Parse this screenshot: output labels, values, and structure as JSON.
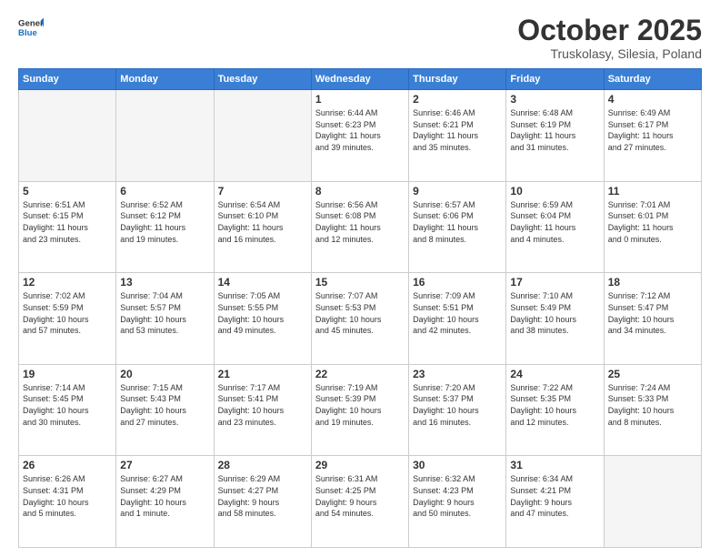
{
  "header": {
    "logo_line1": "General",
    "logo_line2": "Blue",
    "month": "October 2025",
    "location": "Truskolasy, Silesia, Poland"
  },
  "weekdays": [
    "Sunday",
    "Monday",
    "Tuesday",
    "Wednesday",
    "Thursday",
    "Friday",
    "Saturday"
  ],
  "weeks": [
    [
      {
        "day": "",
        "info": ""
      },
      {
        "day": "",
        "info": ""
      },
      {
        "day": "",
        "info": ""
      },
      {
        "day": "1",
        "info": "Sunrise: 6:44 AM\nSunset: 6:23 PM\nDaylight: 11 hours\nand 39 minutes."
      },
      {
        "day": "2",
        "info": "Sunrise: 6:46 AM\nSunset: 6:21 PM\nDaylight: 11 hours\nand 35 minutes."
      },
      {
        "day": "3",
        "info": "Sunrise: 6:48 AM\nSunset: 6:19 PM\nDaylight: 11 hours\nand 31 minutes."
      },
      {
        "day": "4",
        "info": "Sunrise: 6:49 AM\nSunset: 6:17 PM\nDaylight: 11 hours\nand 27 minutes."
      }
    ],
    [
      {
        "day": "5",
        "info": "Sunrise: 6:51 AM\nSunset: 6:15 PM\nDaylight: 11 hours\nand 23 minutes."
      },
      {
        "day": "6",
        "info": "Sunrise: 6:52 AM\nSunset: 6:12 PM\nDaylight: 11 hours\nand 19 minutes."
      },
      {
        "day": "7",
        "info": "Sunrise: 6:54 AM\nSunset: 6:10 PM\nDaylight: 11 hours\nand 16 minutes."
      },
      {
        "day": "8",
        "info": "Sunrise: 6:56 AM\nSunset: 6:08 PM\nDaylight: 11 hours\nand 12 minutes."
      },
      {
        "day": "9",
        "info": "Sunrise: 6:57 AM\nSunset: 6:06 PM\nDaylight: 11 hours\nand 8 minutes."
      },
      {
        "day": "10",
        "info": "Sunrise: 6:59 AM\nSunset: 6:04 PM\nDaylight: 11 hours\nand 4 minutes."
      },
      {
        "day": "11",
        "info": "Sunrise: 7:01 AM\nSunset: 6:01 PM\nDaylight: 11 hours\nand 0 minutes."
      }
    ],
    [
      {
        "day": "12",
        "info": "Sunrise: 7:02 AM\nSunset: 5:59 PM\nDaylight: 10 hours\nand 57 minutes."
      },
      {
        "day": "13",
        "info": "Sunrise: 7:04 AM\nSunset: 5:57 PM\nDaylight: 10 hours\nand 53 minutes."
      },
      {
        "day": "14",
        "info": "Sunrise: 7:05 AM\nSunset: 5:55 PM\nDaylight: 10 hours\nand 49 minutes."
      },
      {
        "day": "15",
        "info": "Sunrise: 7:07 AM\nSunset: 5:53 PM\nDaylight: 10 hours\nand 45 minutes."
      },
      {
        "day": "16",
        "info": "Sunrise: 7:09 AM\nSunset: 5:51 PM\nDaylight: 10 hours\nand 42 minutes."
      },
      {
        "day": "17",
        "info": "Sunrise: 7:10 AM\nSunset: 5:49 PM\nDaylight: 10 hours\nand 38 minutes."
      },
      {
        "day": "18",
        "info": "Sunrise: 7:12 AM\nSunset: 5:47 PM\nDaylight: 10 hours\nand 34 minutes."
      }
    ],
    [
      {
        "day": "19",
        "info": "Sunrise: 7:14 AM\nSunset: 5:45 PM\nDaylight: 10 hours\nand 30 minutes."
      },
      {
        "day": "20",
        "info": "Sunrise: 7:15 AM\nSunset: 5:43 PM\nDaylight: 10 hours\nand 27 minutes."
      },
      {
        "day": "21",
        "info": "Sunrise: 7:17 AM\nSunset: 5:41 PM\nDaylight: 10 hours\nand 23 minutes."
      },
      {
        "day": "22",
        "info": "Sunrise: 7:19 AM\nSunset: 5:39 PM\nDaylight: 10 hours\nand 19 minutes."
      },
      {
        "day": "23",
        "info": "Sunrise: 7:20 AM\nSunset: 5:37 PM\nDaylight: 10 hours\nand 16 minutes."
      },
      {
        "day": "24",
        "info": "Sunrise: 7:22 AM\nSunset: 5:35 PM\nDaylight: 10 hours\nand 12 minutes."
      },
      {
        "day": "25",
        "info": "Sunrise: 7:24 AM\nSunset: 5:33 PM\nDaylight: 10 hours\nand 8 minutes."
      }
    ],
    [
      {
        "day": "26",
        "info": "Sunrise: 6:26 AM\nSunset: 4:31 PM\nDaylight: 10 hours\nand 5 minutes."
      },
      {
        "day": "27",
        "info": "Sunrise: 6:27 AM\nSunset: 4:29 PM\nDaylight: 10 hours\nand 1 minute."
      },
      {
        "day": "28",
        "info": "Sunrise: 6:29 AM\nSunset: 4:27 PM\nDaylight: 9 hours\nand 58 minutes."
      },
      {
        "day": "29",
        "info": "Sunrise: 6:31 AM\nSunset: 4:25 PM\nDaylight: 9 hours\nand 54 minutes."
      },
      {
        "day": "30",
        "info": "Sunrise: 6:32 AM\nSunset: 4:23 PM\nDaylight: 9 hours\nand 50 minutes."
      },
      {
        "day": "31",
        "info": "Sunrise: 6:34 AM\nSunset: 4:21 PM\nDaylight: 9 hours\nand 47 minutes."
      },
      {
        "day": "",
        "info": ""
      }
    ]
  ]
}
